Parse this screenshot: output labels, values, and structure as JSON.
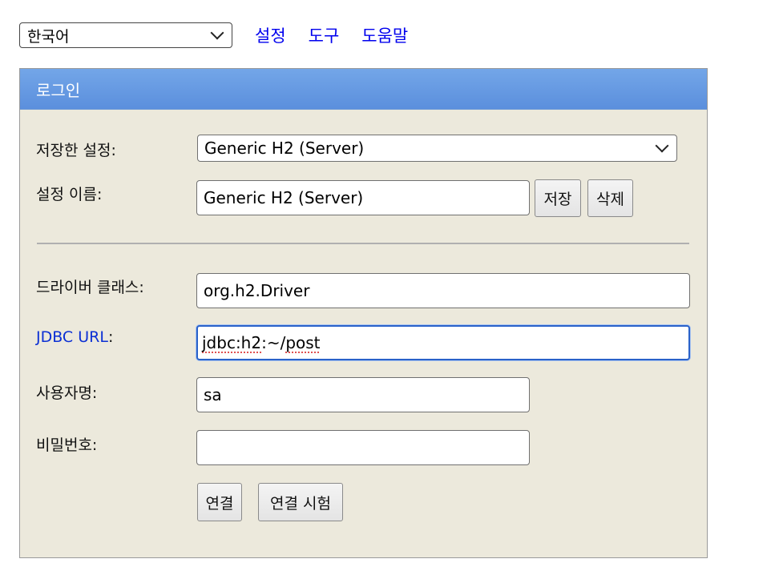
{
  "top": {
    "language": "한국어",
    "links": [
      "설정",
      "도구",
      "도움말"
    ]
  },
  "panel": {
    "title": "로그인",
    "saved_settings_label": "저장한 설정:",
    "saved_settings_value": "Generic H2 (Server)",
    "setting_name_label": "설정 이름:",
    "setting_name_value": "Generic H2 (Server)",
    "save_button": "저장",
    "delete_button": "삭제",
    "driver_class_label": "드라이버 클래스:",
    "driver_class_value": "org.h2.Driver",
    "jdbc_url_label": "JDBC URL",
    "jdbc_url_colon": ":",
    "jdbc_url_value_a": "jdbc:h2",
    "jdbc_url_value_b": ":~/",
    "jdbc_url_value_c": "post",
    "username_label": "사용자명:",
    "username_value": "sa",
    "password_label": "비밀번호:",
    "password_value": "",
    "connect_button": "연결",
    "test_connection_button": "연결 시험"
  },
  "colors": {
    "header_blue": "#5b8fdd",
    "panel_bg": "#ece9dc",
    "link_blue": "#0000ee",
    "focus_blue": "#2a62c9"
  }
}
